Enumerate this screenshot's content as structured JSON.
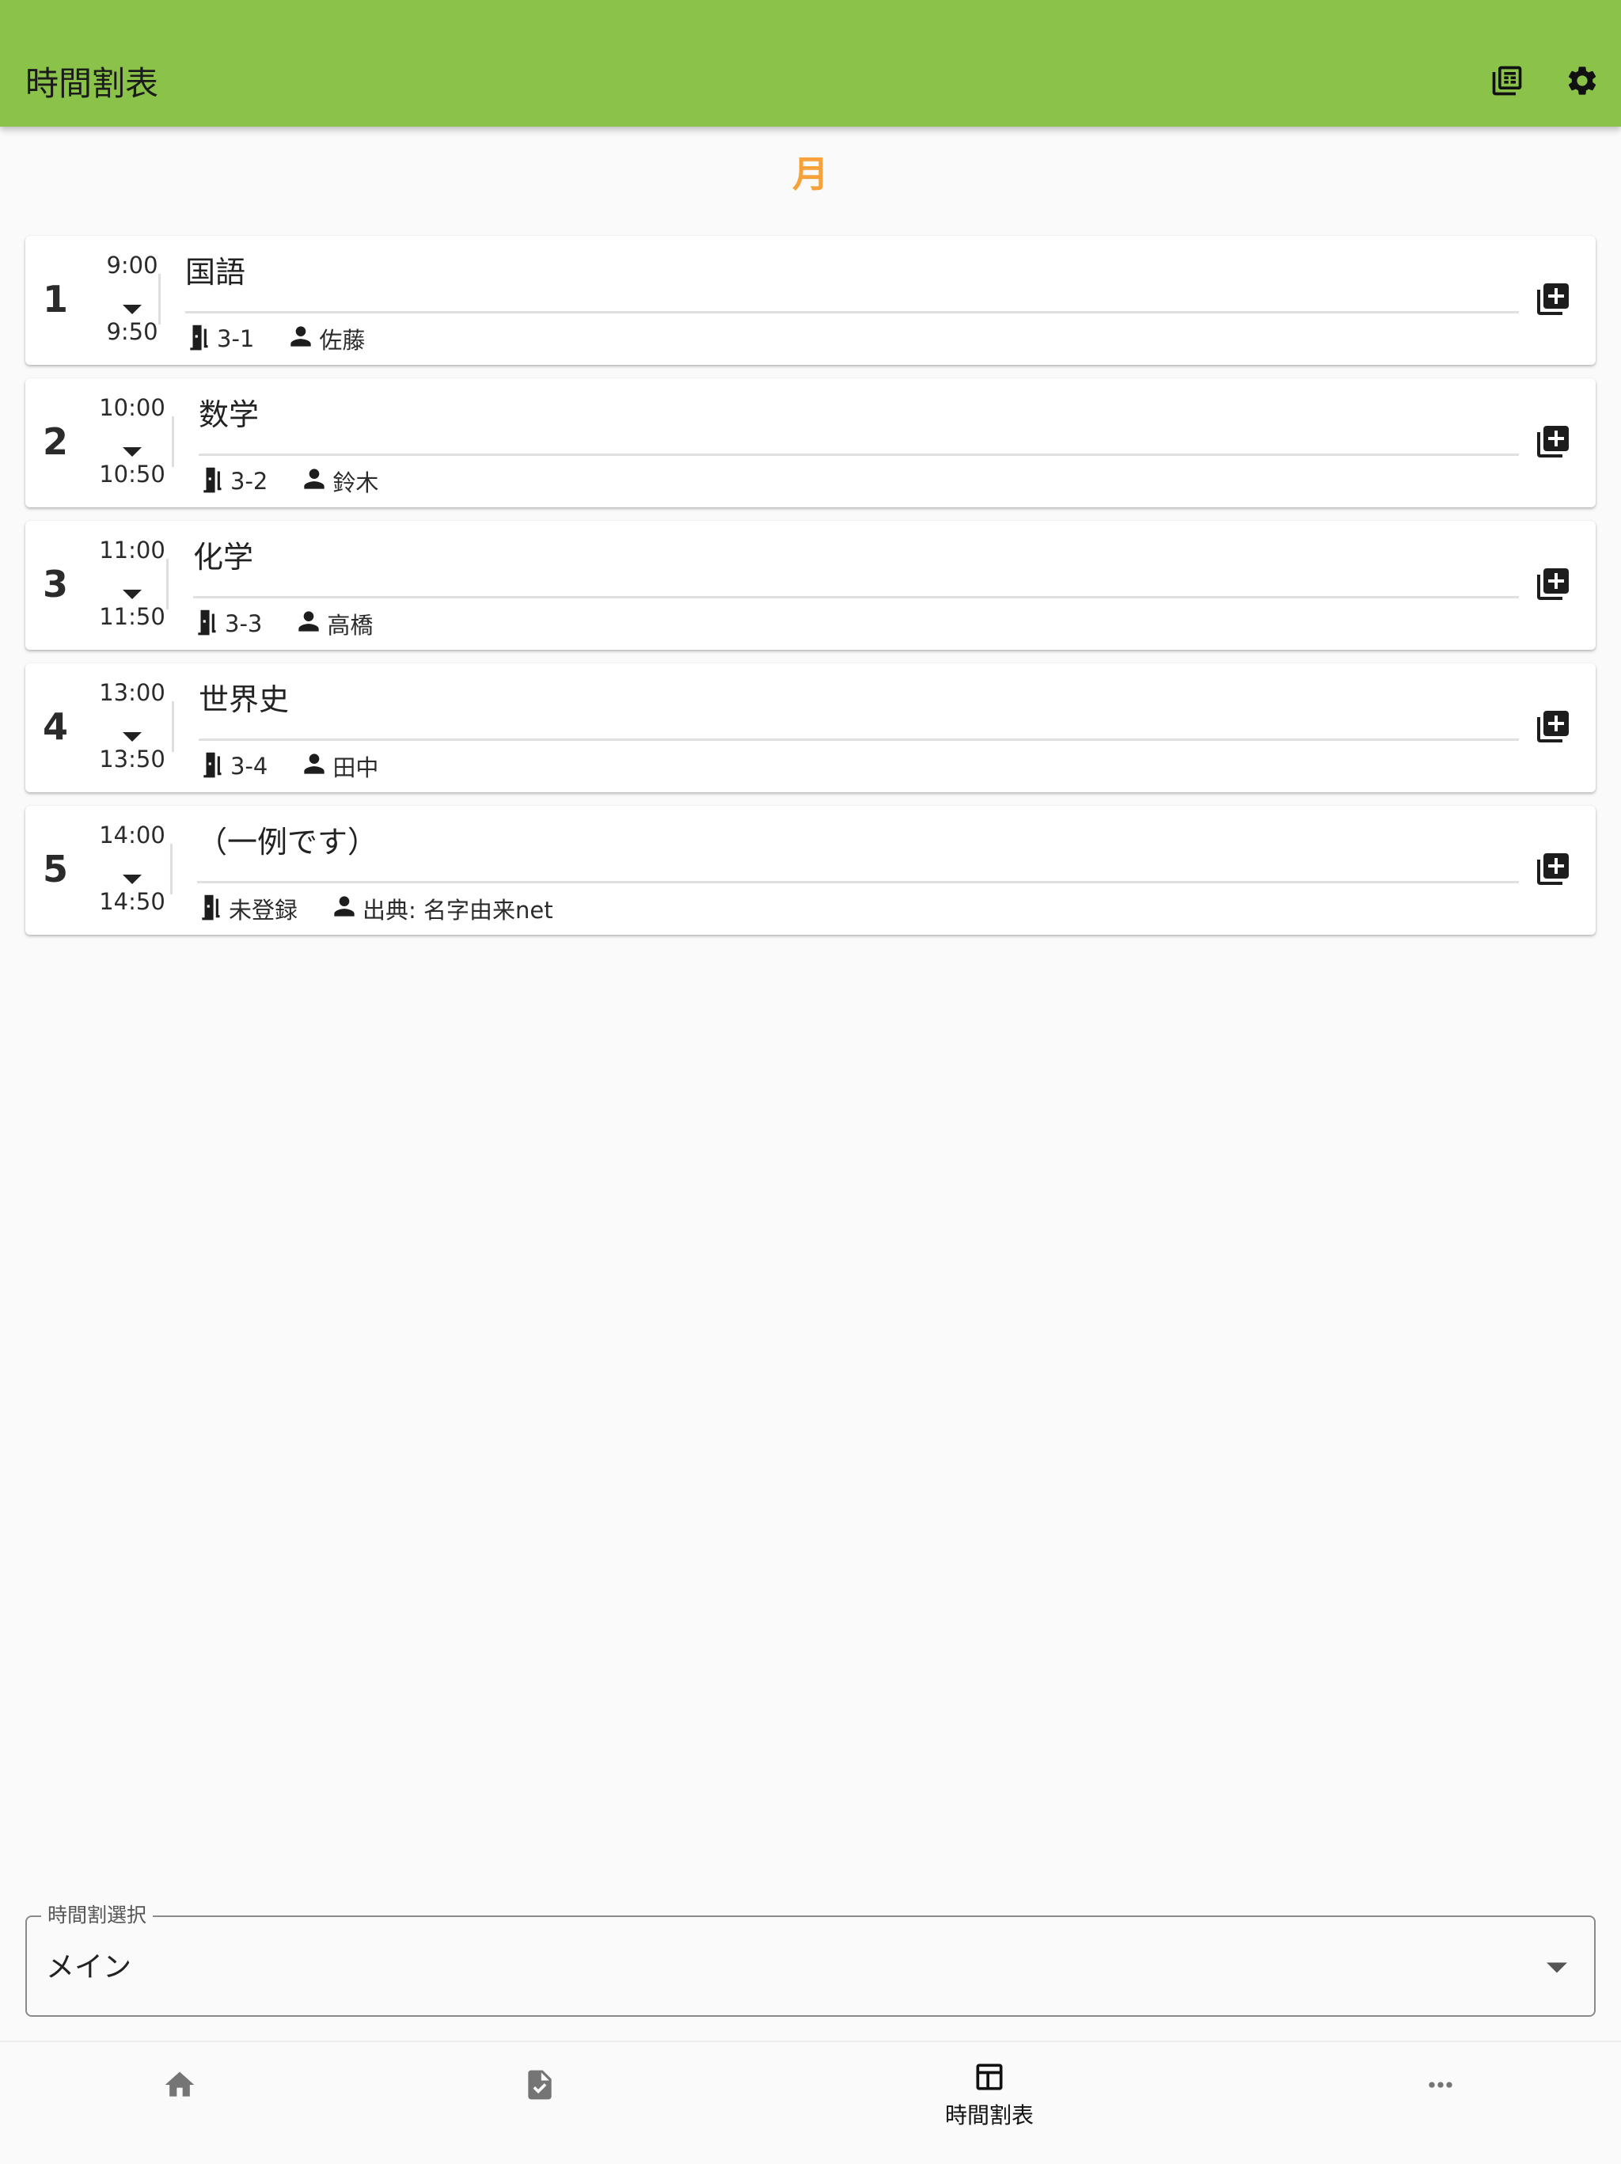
{
  "app_bar": {
    "title": "時間割表",
    "actions": [
      {
        "icon": "timetable-list-icon"
      },
      {
        "icon": "gear-icon"
      }
    ],
    "background_color": "#8bc34a"
  },
  "day_heading": {
    "label": "月",
    "color": "#f6a13a"
  },
  "periods": [
    {
      "number": "1",
      "start": "9:00",
      "end": "9:50",
      "subject": "国語",
      "room": "3-1",
      "teacher": "佐藤"
    },
    {
      "number": "2",
      "start": "10:00",
      "end": "10:50",
      "subject": "数学",
      "room": "3-2",
      "teacher": "鈴木"
    },
    {
      "number": "3",
      "start": "11:00",
      "end": "11:50",
      "subject": "化学",
      "room": "3-3",
      "teacher": "高橋"
    },
    {
      "number": "4",
      "start": "13:00",
      "end": "13:50",
      "subject": "世界史",
      "room": "3-4",
      "teacher": "田中"
    },
    {
      "number": "5",
      "start": "14:00",
      "end": "14:50",
      "subject": "（一例です）",
      "room": "未登録",
      "teacher": "出典: 名字由来net"
    }
  ],
  "timetable_select": {
    "label": "時間割選択",
    "value": "メイン"
  },
  "bottom_nav": {
    "items": [
      {
        "icon": "home-icon",
        "label": ""
      },
      {
        "icon": "task-icon",
        "label": ""
      },
      {
        "icon": "timetable-icon",
        "label": "時間割表",
        "active": true
      },
      {
        "icon": "more-icon",
        "label": ""
      }
    ]
  }
}
